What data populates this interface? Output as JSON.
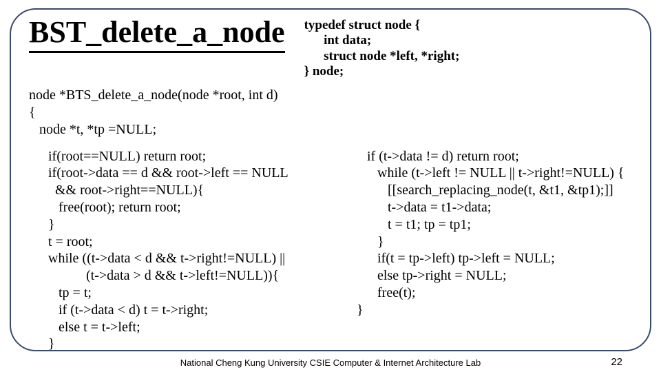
{
  "title": "BST_delete_a_node",
  "typedef": "typedef struct node {\n      int data;\n      struct node *left, *right;\n} node;",
  "func_sig": "node *BTS_delete_a_node(node *root, int d)\n{\n   node *t, *tp =NULL;",
  "left_code": "if(root==NULL) return root;\nif(root->data == d && root->left == NULL\n  && root->right==NULL){\n   free(root); return root;\n}\nt = root;\nwhile ((t->data < d && t->right!=NULL) ||\n           (t->data > d && t->left!=NULL)){\n   tp = t;\n   if (t->data < d) t = t->right;\n   else t = t->left;\n}",
  "right_code": "   if (t->data != d) return root;\n      while (t->left != NULL || t->right!=NULL) {\n         [[search_replacing_node(t, &t1, &tp1);]]\n         t->data = t1->data;\n         t = t1; tp = tp1;\n      }\n      if(t = tp->left) tp->left = NULL;\n      else tp->right = NULL;\n      free(t);\n}",
  "footer": "National Cheng Kung University CSIE Computer & Internet\nArchitecture Lab",
  "pagenum": "22"
}
